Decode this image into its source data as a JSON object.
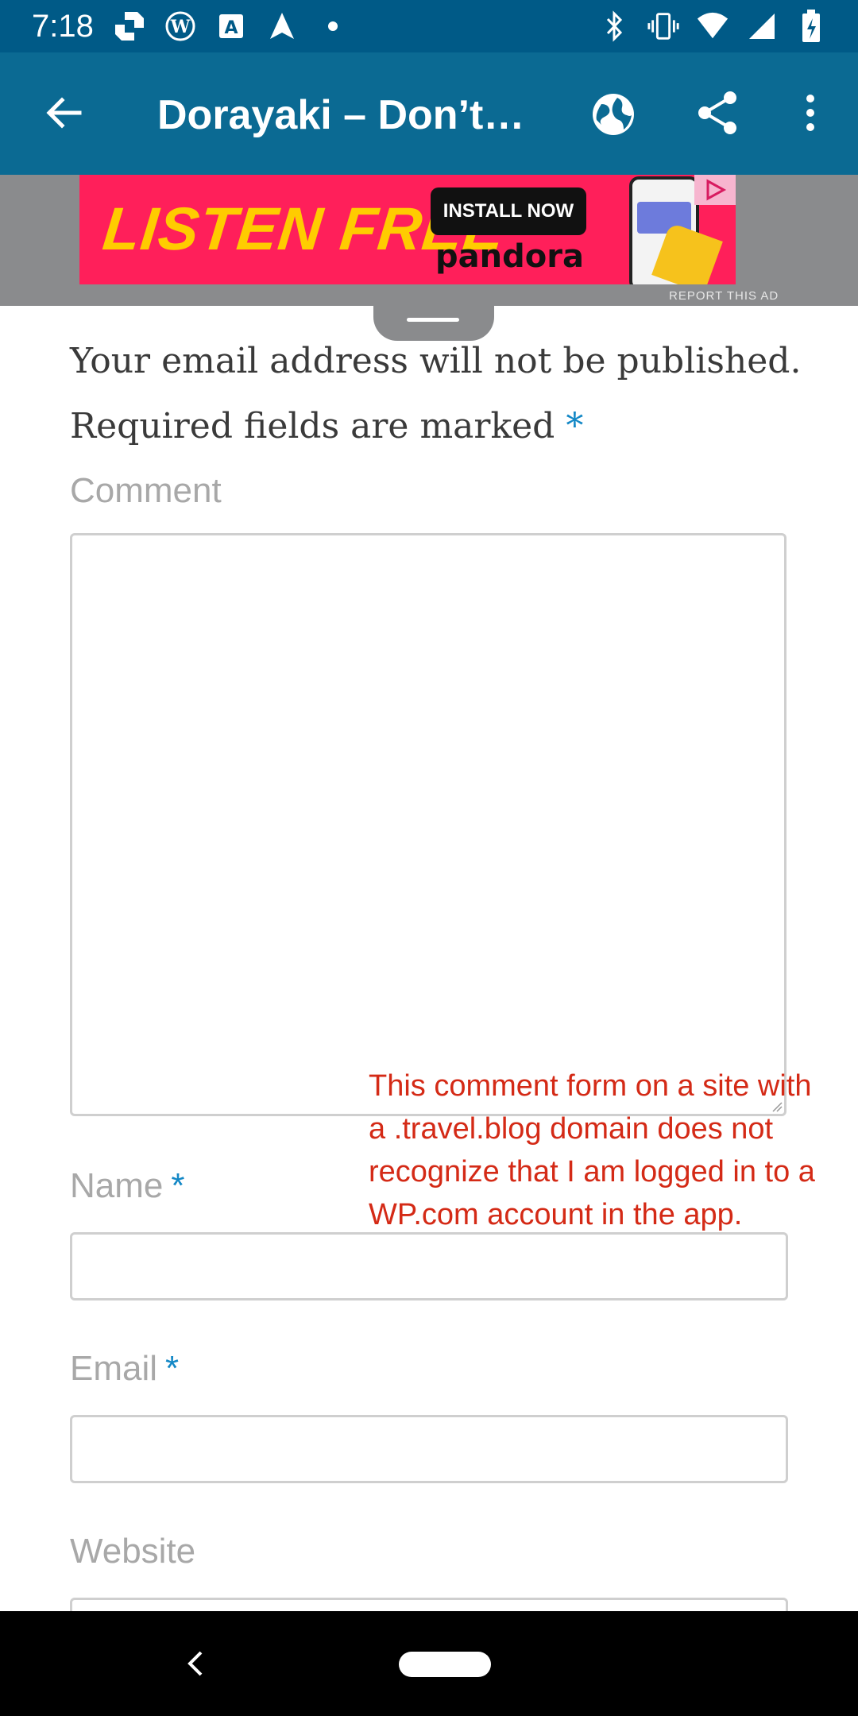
{
  "status_bar": {
    "time": "7:18",
    "left_icons": [
      "chase-icon",
      "wordpress-icon",
      "a-box-icon",
      "navigation-icon",
      "dot-icon"
    ],
    "right_icons": [
      "bluetooth-icon",
      "vibrate-icon",
      "wifi-icon",
      "signal-icon",
      "battery-charging-icon"
    ]
  },
  "app_bar": {
    "title": "Dorayaki – Don’t…",
    "back_icon": "arrow-back-icon",
    "actions": [
      "globe-icon",
      "share-icon",
      "more-vert-icon"
    ],
    "background_color": "#0b6a93"
  },
  "ad": {
    "headline": "LISTEN FREE",
    "cta": "INSTALL NOW",
    "brand": "pandora",
    "report_label": "REPORT THIS AD",
    "background_color": "#ff1f5a"
  },
  "form": {
    "notice_text": "Your email address will not be published. Required fields are marked",
    "required_marker": "*",
    "comment_label": "Comment",
    "name_label": "Name",
    "email_label": "Email",
    "website_label": "Website",
    "accent_color": "#1488c6"
  },
  "annotation": {
    "text": "This comment form on a site with a .travel.blog domain does not recognize that I am logged in to a WP.com account in the app.",
    "color": "#d42a16"
  },
  "nav_bar": {
    "back_icon": "nav-back-icon",
    "home_icon": "nav-home-pill"
  }
}
